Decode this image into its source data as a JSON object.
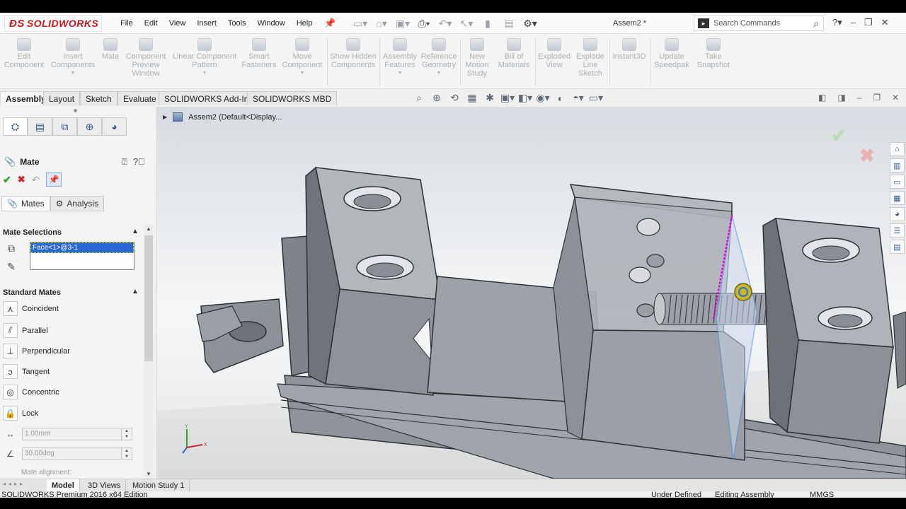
{
  "app": {
    "logo_text": "SOLIDWORKS",
    "document_title": "Assem2 *"
  },
  "menu": [
    "File",
    "Edit",
    "View",
    "Insert",
    "Tools",
    "Window",
    "Help"
  ],
  "search": {
    "placeholder": "Search Commands"
  },
  "command_manager": {
    "items": [
      {
        "label": "Edit Component"
      },
      {
        "label": "Insert Components"
      },
      {
        "label": "Mate"
      },
      {
        "label": "Component Preview Window"
      },
      {
        "label": "Linear Component Pattern"
      },
      {
        "label": "Smart Fasteners"
      },
      {
        "label": "Move Component"
      },
      {
        "label": "Show Hidden Components"
      },
      {
        "label": "Assembly Features"
      },
      {
        "label": "Reference Geometry"
      },
      {
        "label": "New Motion Study"
      },
      {
        "label": "Bill of Materials"
      },
      {
        "label": "Exploded View"
      },
      {
        "label": "Explode Line Sketch"
      },
      {
        "label": "Instant3D"
      },
      {
        "label": "Update Speedpak"
      },
      {
        "label": "Take Snapshot"
      }
    ]
  },
  "command_tabs": [
    "Assembly",
    "Layout",
    "Sketch",
    "Evaluate",
    "SOLIDWORKS Add-Ins",
    "SOLIDWORKS MBD"
  ],
  "property_manager": {
    "title": "Mate",
    "subtabs": [
      "Mates",
      "Analysis"
    ],
    "mate_selections": {
      "heading": "Mate Selections",
      "items": [
        "Face<1>@3-1"
      ]
    },
    "standard_mates": {
      "heading": "Standard Mates",
      "items": [
        "Coincident",
        "Parallel",
        "Perpendicular",
        "Tangent",
        "Concentric",
        "Lock"
      ]
    },
    "distance_value": "1.00mm",
    "angle_value": "30.00deg",
    "mate_alignment_label": "Mate alignment:"
  },
  "feature_tree": {
    "root": "Assem2  (Default<Display..."
  },
  "bottom_tabs": [
    "Model",
    "3D Views",
    "Motion Study 1"
  ],
  "status_bar": {
    "edition": "SOLIDWORKS Premium 2016 x64 Edition",
    "state": "Under Defined",
    "mode": "Editing Assembly",
    "units": "MMGS"
  },
  "colors": {
    "brand_red": "#c8161d",
    "selection_blue": "#2a68d4",
    "ok_green": "#2ea02e",
    "cancel_red": "#d0252b",
    "model_gray": "#888e97"
  }
}
